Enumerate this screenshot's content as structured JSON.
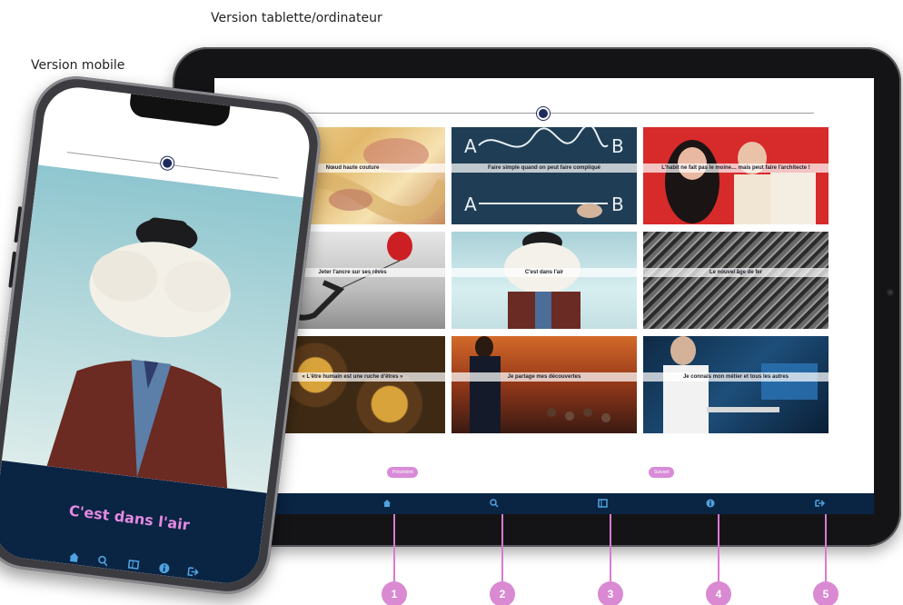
{
  "captions": {
    "tablet": "Version tablette/ordinateur",
    "mobile": "Version mobile"
  },
  "tablet": {
    "tiles": [
      {
        "label": "Nœud haute couture"
      },
      {
        "label": "Faire simple quand on peut faire compliqué"
      },
      {
        "label": "L'habit ne fait pas le moine… mais peut faire l'architecte !"
      },
      {
        "label": "Jeter l'ancre sur ses rêves"
      },
      {
        "label": "C'est dans l'air"
      },
      {
        "label": "Le nouvel âge de fer"
      },
      {
        "label": "« L'être humain est une ruche d'êtres »"
      },
      {
        "label": "Je partage mes découvertes"
      },
      {
        "label": "Je connais mon métier et tous les autres"
      }
    ],
    "prev_label": "Précédent",
    "next_label": "Suivant",
    "nav_icons": [
      "monitor-icon",
      "home-icon",
      "search-icon",
      "map-icon",
      "info-icon",
      "logout-icon"
    ]
  },
  "callouts": [
    "1",
    "2",
    "3",
    "4",
    "5"
  ],
  "phone": {
    "title": "C'est dans l'air",
    "nav_icons": [
      "home-icon",
      "search-icon",
      "map-icon",
      "info-icon",
      "logout-icon"
    ]
  },
  "colors": {
    "nav_bg": "#0a2443",
    "accent_pink": "#d88bd8",
    "icon_blue": "#4fa3e0"
  }
}
